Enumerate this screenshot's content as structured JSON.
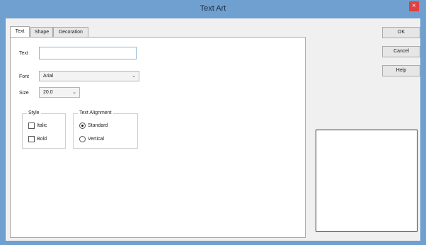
{
  "window": {
    "title": "Text Art",
    "close_label": "×"
  },
  "tabs": [
    {
      "label": "Text",
      "active": true
    },
    {
      "label": "Shape",
      "active": false
    },
    {
      "label": "Decoration",
      "active": false
    }
  ],
  "form": {
    "text_label": "Text",
    "text_value": "",
    "font_label": "Font",
    "font_value": "Arial",
    "size_label": "Size",
    "size_value": "20.0"
  },
  "style": {
    "title": "Style",
    "italic_label": "Italic",
    "italic_checked": false,
    "bold_label": "Bold",
    "bold_checked": false
  },
  "alignment": {
    "title": "Text Alignment",
    "standard_label": "Standard",
    "vertical_label": "Vertical",
    "selected": "Standard"
  },
  "buttons": {
    "ok": "OK",
    "cancel": "Cancel",
    "help": "Help"
  },
  "icons": {
    "dropdown": "chevron-down-icon",
    "close": "close-icon"
  }
}
